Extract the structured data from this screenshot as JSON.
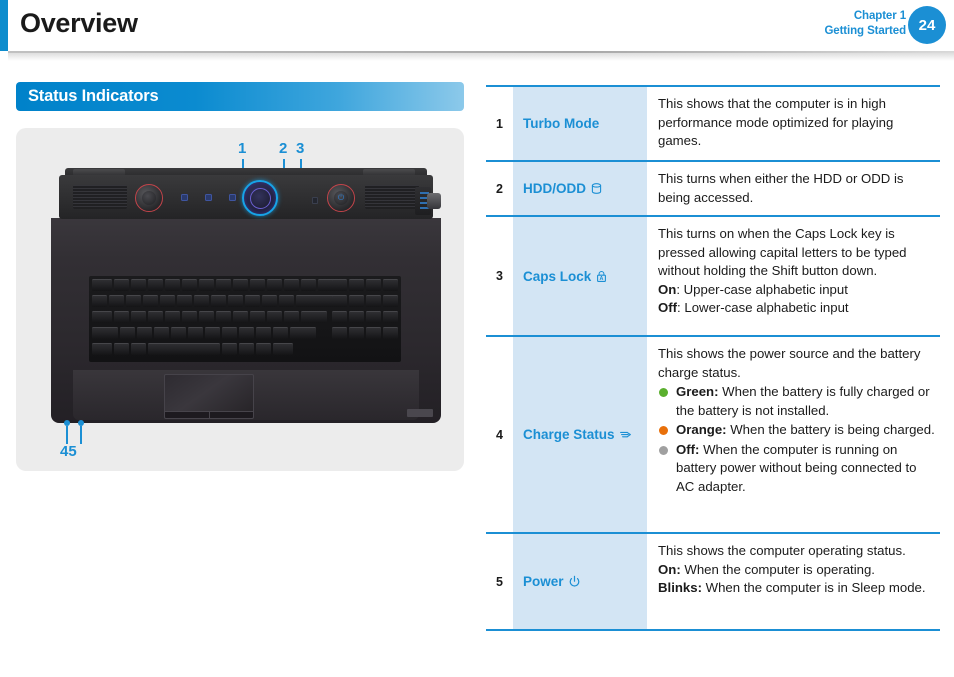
{
  "header": {
    "title": "Overview",
    "chapter_line1": "Chapter 1",
    "chapter_line2": "Getting Started",
    "page_number": "24"
  },
  "section": {
    "title": "Status Indicators"
  },
  "figure": {
    "callouts": [
      "1",
      "2",
      "3",
      "4",
      "5"
    ],
    "callout_bottom_label": "45"
  },
  "table": {
    "rows": [
      {
        "num": "1",
        "label": "Turbo Mode",
        "icon": "",
        "desc": "This shows that the computer is in high performance mode optimized for playing games."
      },
      {
        "num": "2",
        "label": "HDD/ODD",
        "icon": "hdd-icon",
        "desc": "This turns when either the HDD or ODD is being accessed."
      },
      {
        "num": "3",
        "label": "Caps Lock",
        "icon": "caps-lock-icon",
        "desc": "This turns on when the Caps Lock key is pressed allowing capital letters to be typed without holding the Shift button down.",
        "on_label": "On",
        "on_text": ": Upper-case alphabetic input",
        "off_label": "Off",
        "off_text": ": Lower-case alphabetic input"
      },
      {
        "num": "4",
        "label": "Charge Status",
        "icon": "charge-status-icon",
        "desc": "This shows the power source and the battery charge status.",
        "bullets": [
          {
            "color": "#5aaf2e",
            "term": "Green:",
            "text": " When the battery is fully charged or the battery is not installed."
          },
          {
            "color": "#e8700a",
            "term": "Orange:",
            "text": " When the battery is being charged."
          },
          {
            "color": "#a0a0a0",
            "term": "Off:",
            "text": " When the computer is running on battery power without being connected to AC adapter."
          }
        ]
      },
      {
        "num": "5",
        "label": "Power",
        "icon": "power-icon",
        "desc": "This shows the computer operating status.",
        "on_label": "On:",
        "on_text": " When the computer is operating.",
        "blinks_label": "Blinks:",
        "blinks_text": " When the computer is in Sleep mode."
      }
    ]
  },
  "colors": {
    "accent_blue": "#1b8fd4",
    "section_blue": "#0082ca",
    "label_bg": "#d3e5f4",
    "green": "#5aaf2e",
    "orange": "#e8700a",
    "gray": "#a0a0a0"
  }
}
